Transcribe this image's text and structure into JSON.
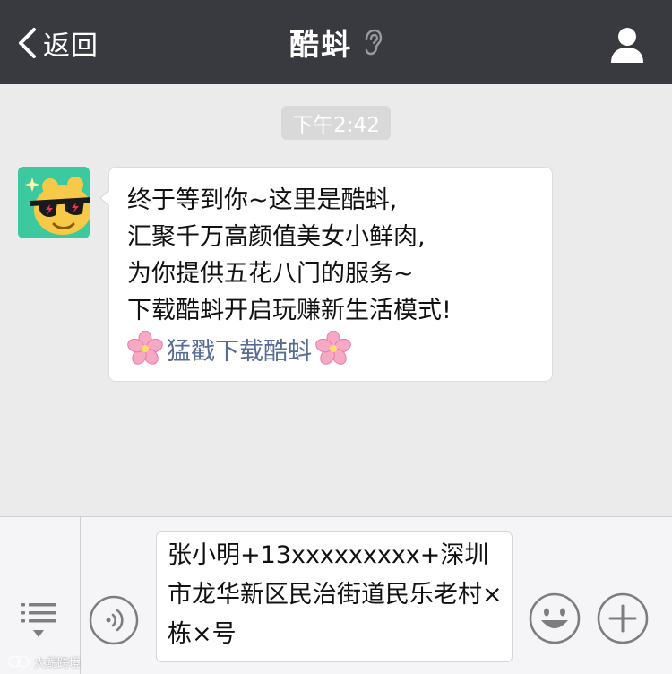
{
  "navbar": {
    "back_label": "返回",
    "title": "酷蚪",
    "background": "#393a3f"
  },
  "chat": {
    "timestamp": "下午2:42",
    "message": {
      "lines": [
        "终于等到你~这里是酷蚪,",
        "汇聚千万高颜值美女小鲜肉,",
        "为你提供五花八门的服务~",
        "下载酷蚪开启玩赚新生活模式!"
      ],
      "link_text": "猛戳下载酷蚪",
      "link_color": "#576b95",
      "decoration_icon": "cherry-blossom-icon"
    },
    "avatar_icon": "sunglasses-bear-avatar"
  },
  "input_bar": {
    "value": "张小明+13xxxxxxxxx+深圳市龙华新区民治街道民乐老村×栋×号",
    "icons": [
      "menu-list-icon",
      "voice-icon",
      "emoji-icon",
      "plus-icon"
    ]
  },
  "watermark": {
    "text": "大鲵跨境"
  }
}
